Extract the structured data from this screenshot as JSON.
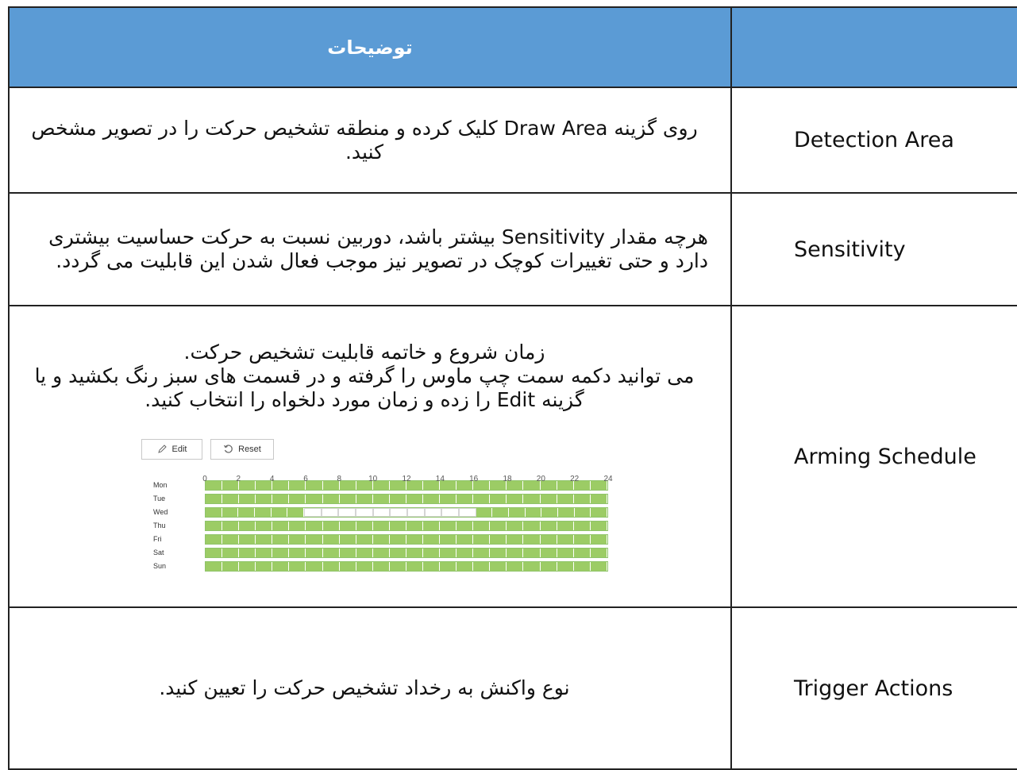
{
  "header": {
    "description_title": "توضیحات",
    "name_title": ""
  },
  "rows": [
    {
      "name": "Detection Area",
      "desc": [
        "روی گزینه Draw Area کلیک کرده و منطقه تشخیص حرکت را در تصویر مشخص کنید."
      ]
    },
    {
      "name": "Sensitivity",
      "desc": [
        "هرچه مقدار Sensitivity بیشتر باشد، دوربین نسبت به حرکت حساسیت بیشتری دارد و حتی تغییرات کوچک در تصویر  نیز موجب فعال شدن این قابلیت می گردد."
      ]
    },
    {
      "name": "Arming Schedule",
      "desc": [
        "زمان شروع و خاتمه قابلیت تشخیص حرکت.",
        "می توانید دکمه سمت چپ ماوس را گرفته و در قسمت های سبز رنگ بکشید و یا گزینه Edit را زده و زمان مورد دلخواه را انتخاب کنید."
      ]
    },
    {
      "name": "Trigger Actions",
      "desc": [
        "نوع واکنش به رخداد تشخیص حرکت را تعیین کنید."
      ]
    }
  ],
  "schedule": {
    "edit_label": "Edit",
    "reset_label": "Reset",
    "edit_icon": "pencil-icon",
    "reset_icon": "reset-icon",
    "hour_ticks": [
      "0",
      "2",
      "4",
      "6",
      "8",
      "10",
      "12",
      "14",
      "16",
      "18",
      "20",
      "22",
      "24"
    ],
    "days": [
      "Mon",
      "Tue",
      "Wed",
      "Thu",
      "Fri",
      "Sat",
      "Sun"
    ],
    "slots_per_day": 24,
    "armed_hours": {
      "Mon": [
        [
          0,
          24
        ]
      ],
      "Tue": [
        [
          0,
          24
        ]
      ],
      "Wed": [
        [
          0,
          5.3
        ],
        [
          16,
          24
        ]
      ],
      "Thu": [
        [
          0,
          24
        ]
      ],
      "Fri": [
        [
          0,
          24
        ]
      ],
      "Sat": [
        [
          0,
          24
        ]
      ],
      "Sun": [
        [
          0,
          24
        ]
      ]
    },
    "armed_color": "#9ccc65"
  },
  "colors": {
    "header_bg": "#5b9bd5",
    "header_text": "#ffffff",
    "border": "#222222"
  }
}
